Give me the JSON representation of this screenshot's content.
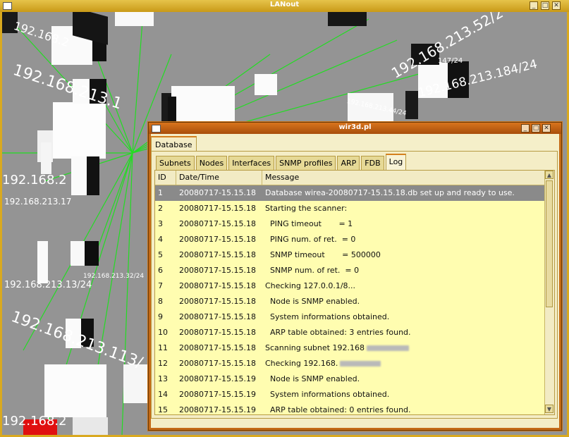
{
  "main_window": {
    "title": "LANout",
    "menu_icon": "window-menu-icon",
    "buttons": [
      "minimize",
      "maximize",
      "close"
    ],
    "button_glyphs": [
      "_",
      "□",
      "✕"
    ]
  },
  "scene": {
    "labels": [
      "192.168.213.52/2",
      "192.168.213.184/24",
      "147/24",
      "192.168.213.113/",
      "192.168.213.1",
      "192.168.2",
      "192.168.2",
      "192.168.213.17",
      "192.168.213.13/24",
      "192.168.213.32/24",
      "192.168.213.44/24",
      "192.168.2"
    ]
  },
  "dialog": {
    "title": "wir3d.pl",
    "top_tab": "Database",
    "tabs": [
      "Subnets",
      "Nodes",
      "Interfaces",
      "SNMP profiles",
      "ARP",
      "FDB",
      "Log"
    ],
    "active_tab": "Log",
    "columns": [
      "ID",
      "Date/Time",
      "Message"
    ],
    "rows": [
      {
        "id": "1",
        "dt": "20080717-15.15.18",
        "msg": "Database wirea-20080717-15.15.18.db set up and ready to use."
      },
      {
        "id": "2",
        "dt": "20080717-15.15.18",
        "msg": "Starting the scanner:"
      },
      {
        "id": "3",
        "dt": "20080717-15.15.18",
        "msg": "  PING timeout       = 1"
      },
      {
        "id": "4",
        "dt": "20080717-15.15.18",
        "msg": "  PING num. of ret.  = 0"
      },
      {
        "id": "5",
        "dt": "20080717-15.15.18",
        "msg": "  SNMP timeout       = 500000"
      },
      {
        "id": "6",
        "dt": "20080717-15.15.18",
        "msg": "  SNMP num. of ret.  = 0"
      },
      {
        "id": "7",
        "dt": "20080717-15.15.18",
        "msg": "Checking 127.0.0.1/8..."
      },
      {
        "id": "8",
        "dt": "20080717-15.15.18",
        "msg": "  Node is SNMP enabled."
      },
      {
        "id": "9",
        "dt": "20080717-15.15.18",
        "msg": "  System informations obtained."
      },
      {
        "id": "10",
        "dt": "20080717-15.15.18",
        "msg": "  ARP table obtained: 3 entries found."
      },
      {
        "id": "11",
        "dt": "20080717-15.15.18",
        "msg": "Scanning subnet 192.168"
      },
      {
        "id": "12",
        "dt": "20080717-15.15.18",
        "msg": "Checking 192.168."
      },
      {
        "id": "13",
        "dt": "20080717-15.15.19",
        "msg": "  Node is SNMP enabled."
      },
      {
        "id": "14",
        "dt": "20080717-15.15.19",
        "msg": "  System informations obtained."
      },
      {
        "id": "15",
        "dt": "20080717-15.15.19",
        "msg": "  ARP table obtained: 0 entries found."
      }
    ],
    "selected_row": "1"
  }
}
